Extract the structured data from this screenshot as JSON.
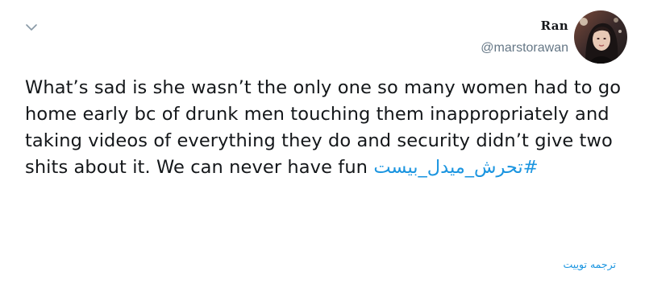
{
  "tweet": {
    "author": {
      "display_name": "Ran",
      "handle": "@marstorawan"
    },
    "text": "What’s sad is she wasn’t the only one so many women had to go home early bc of drunk men touching them inappropriately and taking videos of everything they do and security didn’t give two shits about it. We can never have fun",
    "hashtag": "#تحرش_میدل_بیست",
    "translate_label": "ترجمه توییت"
  },
  "icons": {
    "menu": "chevron-down-icon"
  },
  "colors": {
    "link": "#1b95e0",
    "text": "#14171a",
    "secondary_text": "#657786",
    "icon": "#aab8c2"
  }
}
